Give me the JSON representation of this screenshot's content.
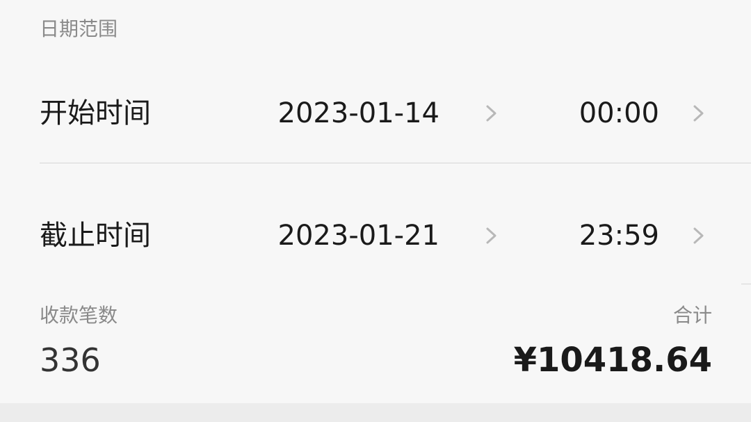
{
  "date_range": {
    "section_label": "日期范围",
    "start": {
      "label": "开始时间",
      "date": "2023-01-14",
      "time": "00:00"
    },
    "end": {
      "label": "截止时间",
      "date": "2023-01-21",
      "time": "23:59"
    }
  },
  "summary": {
    "count_label": "收款笔数",
    "count_value": "336",
    "total_label": "合计",
    "total_value": "¥10418.64"
  },
  "icons": {
    "picker_arrow": "chevron-right-icon"
  },
  "colors": {
    "background": "#f7f7f7",
    "primary_text": "#1a1a1a",
    "secondary_text": "#8a8a8a",
    "chevron": "#b8b8b8",
    "divider": "#d5d5d5"
  }
}
